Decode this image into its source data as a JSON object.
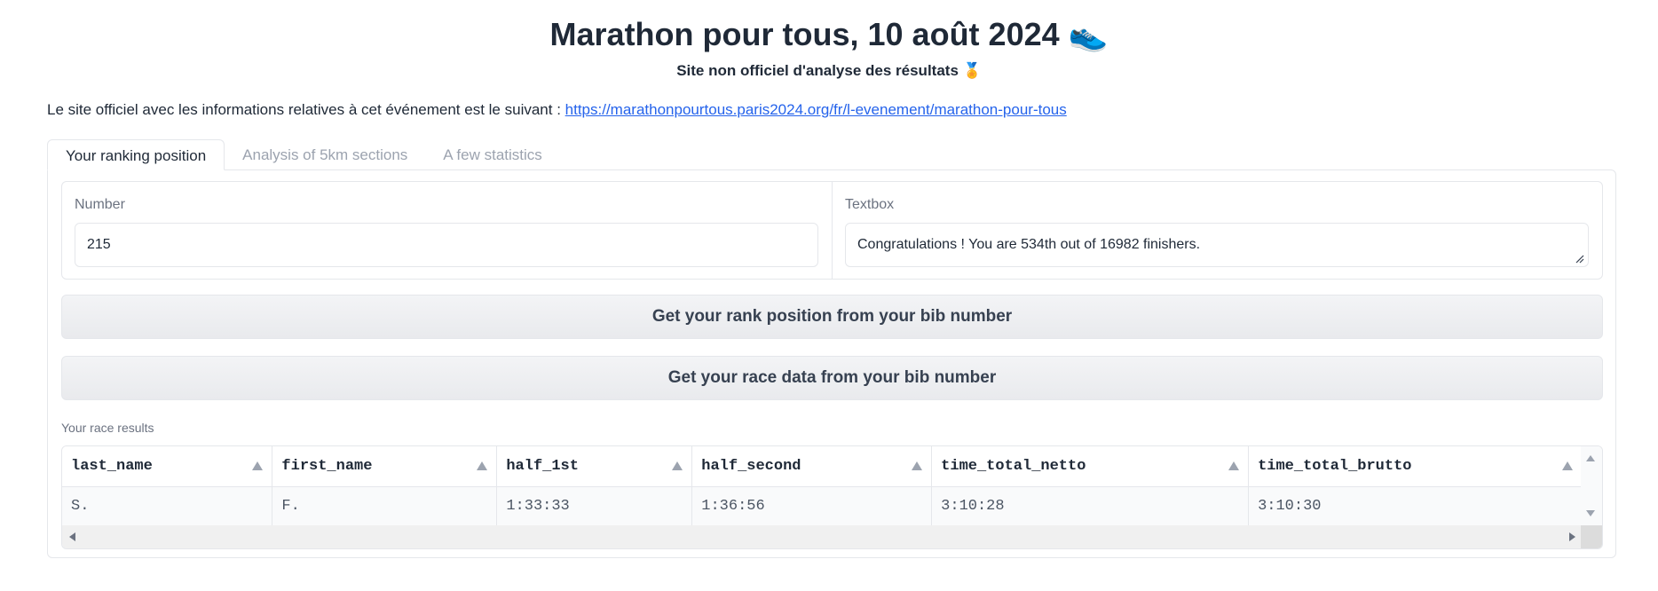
{
  "header": {
    "title": "Marathon pour tous, 10 août 2024 👟",
    "subtitle": "Site non officiel d'analyse des résultats 🏅",
    "intro_text": "Le site officiel avec les informations relatives à cet événement est le suivant : ",
    "intro_link": "https://marathonpourtous.paris2024.org/fr/l-evenement/marathon-pour-tous"
  },
  "tabs": [
    {
      "label": "Your ranking position",
      "active": true
    },
    {
      "label": "Analysis of 5km sections",
      "active": false
    },
    {
      "label": "A few statistics",
      "active": false
    }
  ],
  "number_input": {
    "label": "Number",
    "value": "215"
  },
  "textbox": {
    "label": "Textbox",
    "value": "Congratulations ! You are 534th out of 16982 finishers."
  },
  "buttons": {
    "rank": "Get your rank position from your bib number",
    "race_data": "Get your race data from your bib number"
  },
  "results": {
    "label": "Your race results",
    "columns": [
      "last_name",
      "first_name",
      "half_1st",
      "half_second",
      "time_total_netto",
      "time_total_brutto"
    ],
    "rows": [
      [
        "S.",
        "F.",
        "1:33:33",
        "1:36:56",
        "3:10:28",
        "3:10:30"
      ]
    ]
  },
  "colors": {
    "link": "#2563eb",
    "border": "#e5e7eb",
    "muted": "#9ca3af"
  }
}
